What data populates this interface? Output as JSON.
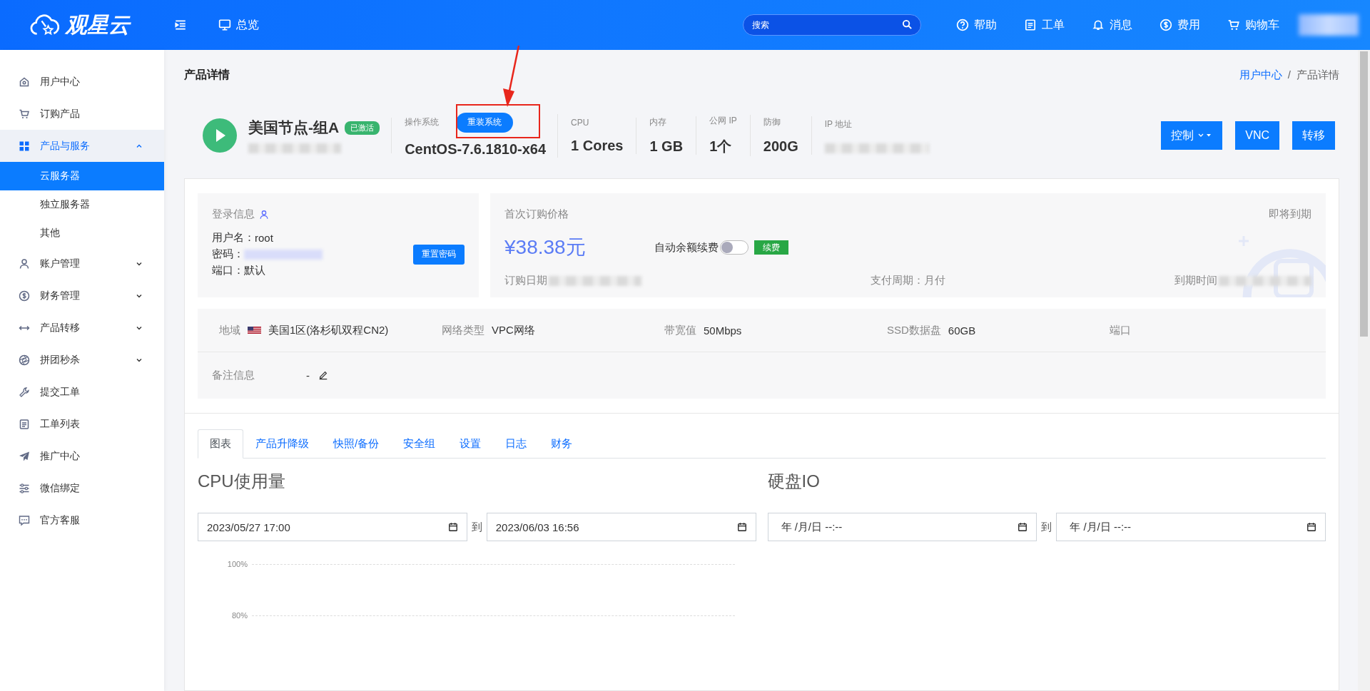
{
  "header": {
    "logo_text": "观星云",
    "nav_label": "总览",
    "search": {
      "placeholder": "搜索"
    },
    "links": [
      {
        "label": "帮助"
      },
      {
        "label": "工单"
      },
      {
        "label": "消息"
      },
      {
        "label": "费用"
      },
      {
        "label": "购物车"
      }
    ]
  },
  "sidebar": {
    "items": [
      {
        "label": "用户中心",
        "selected": false
      },
      {
        "label": "订购产品",
        "selected": false
      },
      {
        "label": "产品与服务",
        "selected": false,
        "expanded": true,
        "children": [
          {
            "label": "云服务器",
            "selected": true
          },
          {
            "label": "独立服务器",
            "selected": false
          },
          {
            "label": "其他",
            "selected": false
          }
        ]
      },
      {
        "label": "账户管理",
        "selected": false,
        "expanded": false
      },
      {
        "label": "财务管理",
        "selected": false,
        "expanded": false
      },
      {
        "label": "产品转移",
        "selected": false,
        "expanded": false
      },
      {
        "label": "拼团秒杀",
        "selected": false,
        "expanded": false
      },
      {
        "label": "提交工单",
        "selected": false
      },
      {
        "label": "工单列表",
        "selected": false
      },
      {
        "label": "推广中心",
        "selected": false
      },
      {
        "label": "微信绑定",
        "selected": false
      },
      {
        "label": "官方客服",
        "selected": false
      }
    ]
  },
  "page": {
    "title": "产品详情",
    "breadcrumb_separator": "/",
    "breadcrumb": [
      {
        "label": "用户中心",
        "link": true
      },
      {
        "label": "产品详情",
        "link": false
      }
    ]
  },
  "product": {
    "name": "美国节点-组A",
    "status": "已激活",
    "os_label": "操作系统",
    "reinstall_button": "重装系统",
    "os_value": "CentOS-7.6.1810-x64",
    "specs": [
      {
        "label": "CPU",
        "value": "1 Cores"
      },
      {
        "label": "内存",
        "value": "1 GB"
      },
      {
        "label": "公网 IP",
        "value": "1个"
      },
      {
        "label": "防御",
        "value": "200G"
      }
    ],
    "ip_label": "IP 地址",
    "buttons": [
      {
        "label": "控制",
        "kind": "dropdown"
      },
      {
        "label": "VNC",
        "kind": "plain"
      },
      {
        "label": "转移",
        "kind": "plain"
      }
    ]
  },
  "login": {
    "title": "登录信息",
    "username_label": "用户名：",
    "username": "root",
    "password_label": "密码：",
    "port_label": "端口：",
    "port": "默认",
    "reset_button": "重置密码"
  },
  "billing": {
    "title": "首次订购价格",
    "price": "¥38.38元",
    "auto_renew_label": "自动余额续费",
    "auto_renew_on": false,
    "renew_button": "续费",
    "expiring": "即将到期",
    "order_date_label": "订购日期",
    "cycle": "支付周期：月付",
    "expiry_label": "到期时间"
  },
  "details": {
    "fields": [
      {
        "label": "地域",
        "value": "美国1区(洛杉矶双程CN2)",
        "flag": true
      },
      {
        "label": "网络类型",
        "value": "VPC网络",
        "flag": false
      },
      {
        "label": "带宽值",
        "value": "50Mbps",
        "flag": false
      },
      {
        "label": "SSD数据盘",
        "value": "60GB",
        "flag": false
      }
    ],
    "port_label": "端口",
    "remark_label": "备注信息",
    "remark": "-"
  },
  "tabs": [
    {
      "label": "图表",
      "selected": true
    },
    {
      "label": "产品升降级",
      "selected": false
    },
    {
      "label": "快照/备份",
      "selected": false
    },
    {
      "label": "安全组",
      "selected": false
    },
    {
      "label": "设置",
      "selected": false
    },
    {
      "label": "日志",
      "selected": false
    },
    {
      "label": "财务",
      "selected": false
    }
  ],
  "charts": [
    {
      "title": "CPU使用量",
      "from": {
        "value": "2023/05/27 17:00"
      },
      "separator": "到",
      "to": {
        "value": "2023/06/03 16:56"
      },
      "tick_labels": [
        "100%",
        "80%"
      ]
    },
    {
      "title": "硬盘IO",
      "from": {
        "placeholder": "年 /月/日 --:--"
      },
      "separator": "到",
      "to": {
        "placeholder": "年 /月/日 --:--"
      }
    }
  ]
}
